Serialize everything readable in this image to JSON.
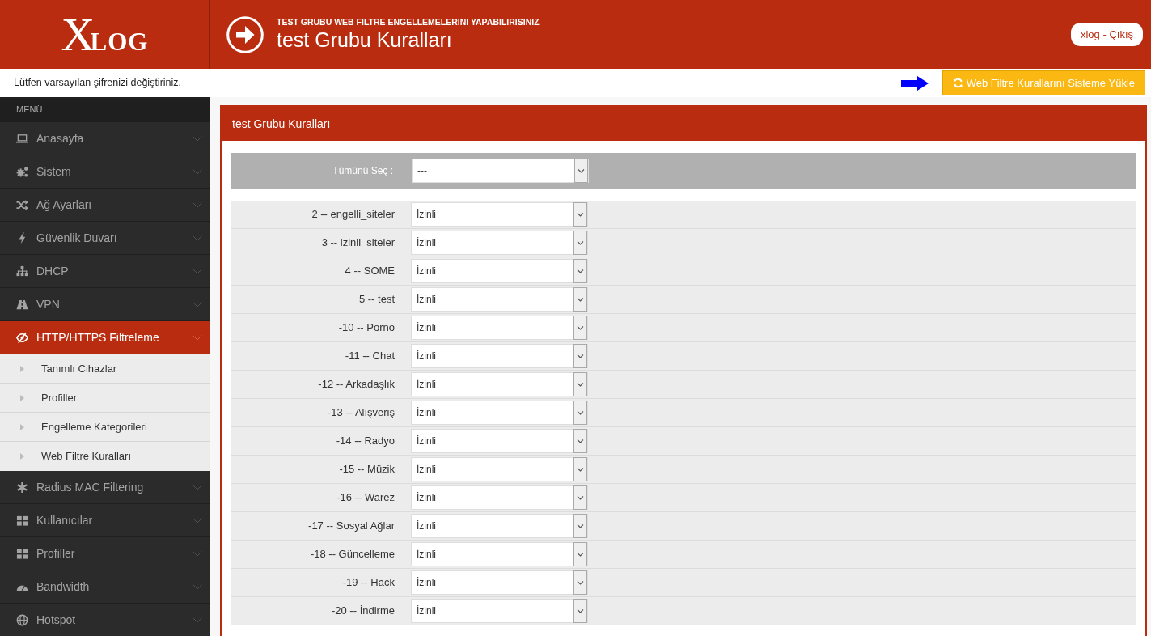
{
  "header": {
    "logo": "XLOG",
    "subtitle": "TEST GRUBU WEB FILTRE ENGELLEMELERINI YAPABILIRISINIZ",
    "title": "test Grubu Kuralları",
    "user_button": "xlog - Çıkış"
  },
  "notice": "Lütfen varsayılan şifrenizi değiştiriniz.",
  "action_button": "Web Filtre Kurallarını Sisteme Yükle",
  "sidebar": {
    "heading": "MENÜ",
    "items": [
      {
        "label": "Anasayfa",
        "selected": false
      },
      {
        "label": "Sistem",
        "selected": false
      },
      {
        "label": "Ağ Ayarları",
        "selected": false
      },
      {
        "label": "Güvenlik Duvarı",
        "selected": false
      },
      {
        "label": "DHCP",
        "selected": false
      },
      {
        "label": "VPN",
        "selected": false
      },
      {
        "label": "HTTP/HTTPS Filtreleme",
        "selected": true,
        "children": [
          {
            "label": "Tanımlı Cihazlar"
          },
          {
            "label": "Profiller"
          },
          {
            "label": "Engelleme Kategorileri"
          },
          {
            "label": "Web Filtre Kuralları"
          }
        ]
      },
      {
        "label": "Radius MAC Filtering",
        "selected": false
      },
      {
        "label": "Kullanıcılar",
        "selected": false
      },
      {
        "label": "Profiller",
        "selected": false
      },
      {
        "label": "Bandwidth",
        "selected": false
      },
      {
        "label": "Hotspot",
        "selected": false
      }
    ]
  },
  "panel": {
    "title": "test Grubu Kuralları",
    "select_all": {
      "label": "Tümünü Seç :",
      "value": "---"
    },
    "rules": [
      {
        "label": "2 -- engelli_siteler",
        "value": "İzinli"
      },
      {
        "label": "3 -- izinli_siteler",
        "value": "İzinli"
      },
      {
        "label": "4 -- SOME",
        "value": "İzinli"
      },
      {
        "label": "5 -- test",
        "value": "İzinli"
      },
      {
        "label": "-10 -- Porno",
        "value": "İzinli"
      },
      {
        "label": "-11 -- Chat",
        "value": "İzinli"
      },
      {
        "label": "-12 -- Arkadaşlık",
        "value": "İzinli"
      },
      {
        "label": "-13 -- Alışveriş",
        "value": "İzinli"
      },
      {
        "label": "-14 -- Radyo",
        "value": "İzinli"
      },
      {
        "label": "-15 -- Müzik",
        "value": "İzinli"
      },
      {
        "label": "-16 -- Warez",
        "value": "İzinli"
      },
      {
        "label": "-17 -- Sosyal Ağlar",
        "value": "İzinli"
      },
      {
        "label": "-18 -- Güncelleme",
        "value": "İzinli"
      },
      {
        "label": "-19 -- Hack",
        "value": "İzinli"
      },
      {
        "label": "-20 -- İndirme",
        "value": "İzinli"
      }
    ]
  }
}
